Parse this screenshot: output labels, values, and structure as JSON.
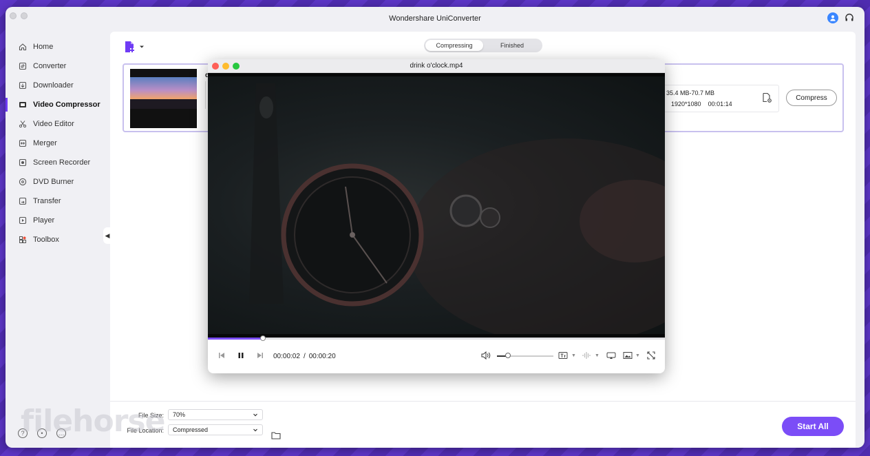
{
  "app": {
    "title": "Wondershare UniConverter"
  },
  "sidebar": {
    "items": [
      {
        "label": "Home",
        "icon": "home-icon",
        "active": false
      },
      {
        "label": "Converter",
        "icon": "converter-icon",
        "active": false
      },
      {
        "label": "Downloader",
        "icon": "downloader-icon",
        "active": false
      },
      {
        "label": "Video Compressor",
        "icon": "video-compressor-icon",
        "active": true
      },
      {
        "label": "Video Editor",
        "icon": "scissors-icon",
        "active": false
      },
      {
        "label": "Merger",
        "icon": "merger-icon",
        "active": false
      },
      {
        "label": "Screen Recorder",
        "icon": "screen-recorder-icon",
        "active": false
      },
      {
        "label": "DVD Burner",
        "icon": "disc-icon",
        "active": false
      },
      {
        "label": "Transfer",
        "icon": "transfer-icon",
        "active": false
      },
      {
        "label": "Player",
        "icon": "player-icon",
        "active": false
      },
      {
        "label": "Toolbox",
        "icon": "toolbox-icon",
        "active": false
      }
    ]
  },
  "tabs": {
    "compressing": "Compressing",
    "finished": "Finished",
    "active": "compressing"
  },
  "file": {
    "name_visible": "d",
    "output_size": "35.4 MB-70.7 MB",
    "format_fragment": "4",
    "resolution": "1920*1080",
    "duration": "00:01:14",
    "compress_label": "Compress"
  },
  "footer": {
    "file_size_label": "File Size:",
    "file_size_value": "70%",
    "file_location_label": "File Location:",
    "file_location_value": "Compressed",
    "start_all_label": "Start All"
  },
  "player": {
    "title": "drink o'clock.mp4",
    "current_time": "00:00:02",
    "separator": "/",
    "total_time": "00:00:20",
    "progress": 0.12,
    "volume": 0.2
  },
  "watermark": "filehorse",
  "colors": {
    "accent": "#7b4df7",
    "background": "#5a35c0"
  }
}
